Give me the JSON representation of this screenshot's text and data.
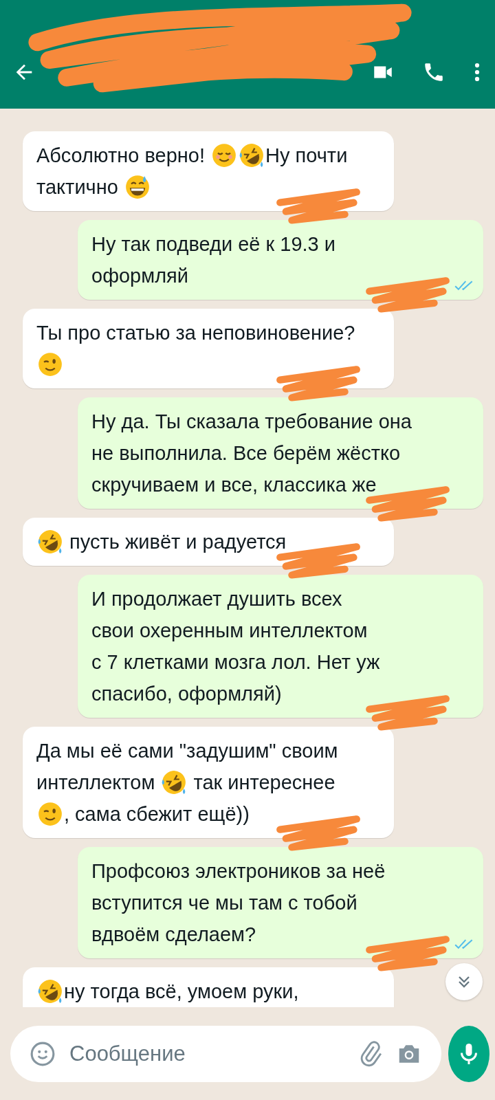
{
  "header": {
    "redacted": true
  },
  "messages": [
    {
      "kind": "incoming",
      "time_redacted": true,
      "lines": [
        [
          {
            "kind": "text",
            "text": "Абсолютно верно! "
          },
          {
            "kind": "relieved"
          },
          {
            "kind": "rofl"
          },
          {
            "kind": "text",
            "text": "Ну почти"
          }
        ],
        [
          {
            "kind": "text",
            "text": "тактично "
          },
          {
            "kind": "sweat"
          }
        ]
      ]
    },
    {
      "kind": "outgoing",
      "time_redacted": true,
      "read": true,
      "lines": [
        [
          {
            "kind": "text",
            "text": "Ну так подведи её к 19.3 и"
          }
        ],
        [
          {
            "kind": "text",
            "text": "оформляй"
          }
        ]
      ]
    },
    {
      "kind": "incoming",
      "time_redacted": true,
      "lines": [
        [
          {
            "kind": "text",
            "text": "Ты про статью за неповиновение?"
          }
        ],
        [
          {
            "kind": "wink"
          }
        ]
      ]
    },
    {
      "kind": "outgoing",
      "time_redacted": true,
      "read": false,
      "lines": [
        [
          {
            "kind": "text",
            "text": "Ну да. Ты сказала требование она"
          }
        ],
        [
          {
            "kind": "text",
            "text": "не выполнила. Все берём жёстко"
          }
        ],
        [
          {
            "kind": "text",
            "text": "скручиваем и все, классика же"
          }
        ]
      ]
    },
    {
      "kind": "incoming",
      "time_redacted": true,
      "lines": [
        [
          {
            "kind": "rofl"
          },
          {
            "kind": "text",
            "text": " пусть живёт и радуется"
          }
        ]
      ]
    },
    {
      "kind": "outgoing",
      "time_redacted": true,
      "read": false,
      "lines": [
        [
          {
            "kind": "text",
            "text": "И продолжает душить всех"
          }
        ],
        [
          {
            "kind": "text",
            "text": "свои охеренным интеллектом"
          }
        ],
        [
          {
            "kind": "text",
            "text": "с 7 клетками мозга лол. Нет уж"
          }
        ],
        [
          {
            "kind": "text",
            "text": "спасибо, оформляй)"
          }
        ]
      ]
    },
    {
      "kind": "incoming",
      "time_redacted": true,
      "lines": [
        [
          {
            "kind": "text",
            "text": "Да мы её сами \"задушим\" своим"
          }
        ],
        [
          {
            "kind": "text",
            "text": "интеллектом "
          },
          {
            "kind": "rofl"
          },
          {
            "kind": "text",
            "text": " так интереснее"
          }
        ],
        [
          {
            "kind": "wink"
          },
          {
            "kind": "text",
            "text": ", сама сбежит ещё))"
          }
        ]
      ]
    },
    {
      "kind": "outgoing",
      "time_redacted": true,
      "read": true,
      "lines": [
        [
          {
            "kind": "text",
            "text": "Профсоюз электроников за неё"
          }
        ],
        [
          {
            "kind": "text",
            "text": "вступится че мы там с тобой"
          }
        ],
        [
          {
            "kind": "text",
            "text": "вдвоём сделаем?"
          }
        ]
      ]
    },
    {
      "kind": "incoming",
      "time_redacted": false,
      "lines": [
        [
          {
            "kind": "rofl"
          },
          {
            "kind": "text",
            "text": "ну тогда всё, умоем руки,"
          }
        ]
      ]
    }
  ],
  "input": {
    "placeholder": "Сообщение"
  }
}
